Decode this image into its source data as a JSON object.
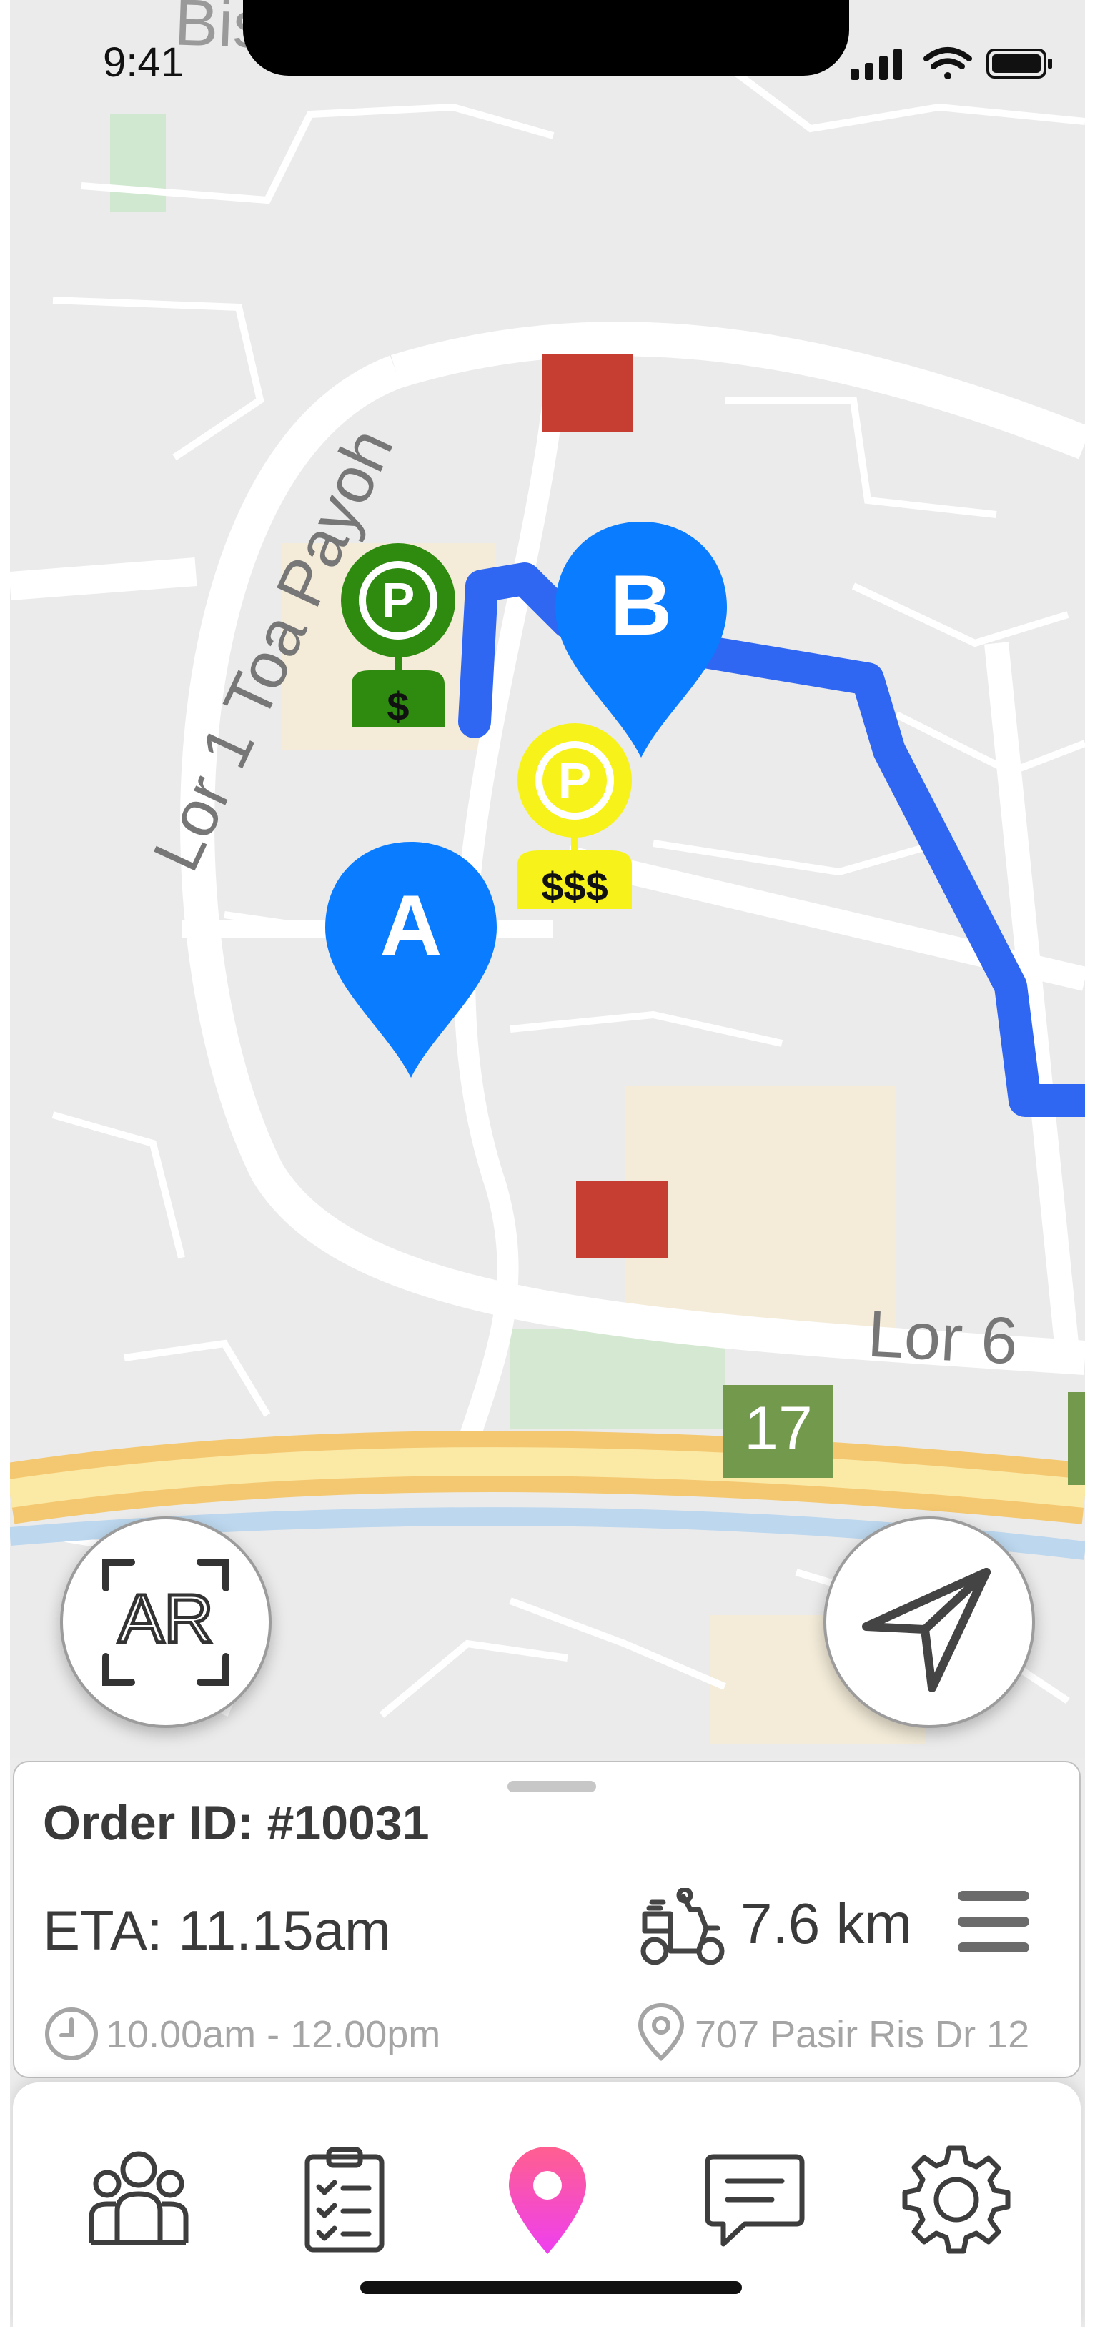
{
  "status_bar": {
    "time": "9:41"
  },
  "map": {
    "street_labels": {
      "top": "Bishan Flyover",
      "left": "Lor 1 Toa Payoh",
      "right": "Lor 6"
    },
    "route_badge": "17",
    "markers": {
      "a_label": "A",
      "b_label": "B"
    },
    "parking": [
      {
        "symbol": "P",
        "price": "$",
        "color": "#2e8b10"
      },
      {
        "symbol": "P",
        "price": "$$$",
        "color": "#f7f21a"
      }
    ],
    "route_color": "#2f66f2"
  },
  "buttons": {
    "ar_label": "AR"
  },
  "order": {
    "order_id": "Order ID: #10031",
    "eta": "ETA: 11.15am",
    "distance": "7.6 km",
    "time_window": "10.00am - 12.00pm",
    "address": "707 Pasir Ris Dr 12"
  },
  "tabbar": {
    "active_color": "#ff5fa8",
    "icons": [
      "team-icon",
      "checklist-icon",
      "map-pin-icon",
      "chat-icon",
      "gear-icon"
    ]
  }
}
